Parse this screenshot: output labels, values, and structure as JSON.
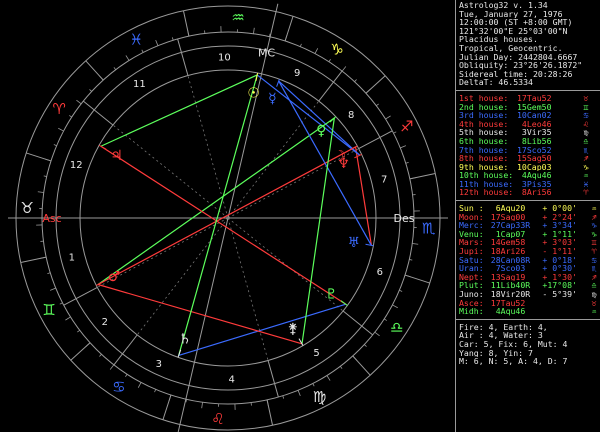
{
  "header": {
    "lines": [
      "Astrolog32 v. 1.34",
      "Tue, January 27, 1976",
      "12:00:00 (ST +8:00 GMT)",
      "121°32'00\"E 25°03'00\"N",
      "Placidus houses.",
      "Tropical, Geocentric.",
      "Julian Day: 2442804.6667",
      "Obliquity: 23°26'26.1872\"",
      "Sidereal time: 20:28:26",
      "DeltaT: 46.5334"
    ]
  },
  "houses": [
    {
      "name": "1st house:",
      "cusp": "17Tau52",
      "sign": "♉",
      "color": "#ff3b3b"
    },
    {
      "name": "2nd house:",
      "cusp": "15Gem50",
      "sign": "♊",
      "color": "#5cff5c"
    },
    {
      "name": "3rd house:",
      "cusp": "10Can02",
      "sign": "♋",
      "color": "#3b6bff"
    },
    {
      "name": "4th house:",
      "cusp": " 4Leo46",
      "sign": "♌",
      "color": "#ff3b3b"
    },
    {
      "name": "5th house:",
      "cusp": " 3Vir35",
      "sign": "♍",
      "color": "#e8e8e8"
    },
    {
      "name": "6th house:",
      "cusp": " 8Lib56",
      "sign": "♎",
      "color": "#5cff5c"
    },
    {
      "name": "7th house:",
      "cusp": "17Sco52",
      "sign": "♏",
      "color": "#3b6bff"
    },
    {
      "name": "8th house:",
      "cusp": "15Sag50",
      "sign": "♐",
      "color": "#ff3b3b"
    },
    {
      "name": "9th house:",
      "cusp": "10Cap03",
      "sign": "♑",
      "color": "#ffff55"
    },
    {
      "name": "10th house:",
      "cusp": " 4Aqu46",
      "sign": "♒",
      "color": "#5cff5c"
    },
    {
      "name": "11th house:",
      "cusp": " 3Pis35",
      "sign": "♓",
      "color": "#3b6bff"
    },
    {
      "name": "12th house:",
      "cusp": " 8Ari56",
      "sign": "♈",
      "color": "#ff3b3b"
    }
  ],
  "planets": [
    {
      "name": "Sun :",
      "pos": " 6Aqu20",
      "lat": "+ 0°00'",
      "sign": "♒",
      "color": "#ffff55"
    },
    {
      "name": "Moon:",
      "pos": "17Sag00",
      "lat": "+ 2°24'",
      "sign": "♐",
      "color": "#ff3b3b"
    },
    {
      "name": "Merc:",
      "pos": "27Cap33R",
      "lat": "+ 3°34'",
      "sign": "♑",
      "color": "#3b6bff"
    },
    {
      "name": "Venu:",
      "pos": " 1Cap07",
      "lat": "+ 1°11'",
      "sign": "♑",
      "color": "#5cff5c"
    },
    {
      "name": "Mars:",
      "pos": "14Gem58",
      "lat": "+ 3°03'",
      "sign": "♊",
      "color": "#ff3b3b"
    },
    {
      "name": "Jupi:",
      "pos": "18Ari26",
      "lat": "- 1°11'",
      "sign": "♈",
      "color": "#ff3b3b"
    },
    {
      "name": "Satu:",
      "pos": "28Can08R",
      "lat": "+ 0°18'",
      "sign": "♋",
      "color": "#3b6bff"
    },
    {
      "name": "Uran:",
      "pos": " 7Sco03",
      "lat": "+ 0°30'",
      "sign": "♏",
      "color": "#3b6bff"
    },
    {
      "name": "Nept:",
      "pos": "13Sag19",
      "lat": "+ 1°30'",
      "sign": "♐",
      "color": "#ff3b3b"
    },
    {
      "name": "Plut:",
      "pos": "11Lib40R",
      "lat": "+17°08'",
      "sign": "♎",
      "color": "#5cff5c"
    },
    {
      "name": "Juno:",
      "pos": "18Vir20R",
      "lat": "- 5°39'",
      "sign": "♍",
      "color": "#e8e8e8"
    },
    {
      "name": "Asce:",
      "pos": "17Tau52",
      "lat": "",
      "sign": "♉",
      "color": "#ff3b3b"
    },
    {
      "name": "Midh:",
      "pos": " 4Aqu46",
      "lat": "",
      "sign": "♒",
      "color": "#5cff5c"
    }
  ],
  "summary": {
    "lines": [
      "Fire: 4, Earth: 4,",
      "Air : 4, Water: 3",
      "Car: 5, Fix: 6, Mut: 4",
      "Yang: 8, Yin: 7",
      "M: 6, N: 5, A: 4, D: 7"
    ]
  },
  "wheel": {
    "zodiac": [
      {
        "glyph": "♈",
        "color": "#ff3b3b"
      },
      {
        "glyph": "♉",
        "color": "#e8e8e8"
      },
      {
        "glyph": "♊",
        "color": "#5cff5c"
      },
      {
        "glyph": "♋",
        "color": "#3b6bff"
      },
      {
        "glyph": "♌",
        "color": "#ff3b3b"
      },
      {
        "glyph": "♍",
        "color": "#e8e8e8"
      },
      {
        "glyph": "♎",
        "color": "#5cff5c"
      },
      {
        "glyph": "♏",
        "color": "#3b6bff"
      },
      {
        "glyph": "♐",
        "color": "#ff3b3b"
      },
      {
        "glyph": "♑",
        "color": "#ffff55"
      },
      {
        "glyph": "♒",
        "color": "#5cff5c"
      },
      {
        "glyph": "♓",
        "color": "#3b6bff"
      }
    ],
    "house_numbers": [
      "1",
      "2",
      "3",
      "4",
      "5",
      "6",
      "7",
      "8",
      "9",
      "10",
      "11",
      "12"
    ],
    "axis_labels": {
      "asc": "Asc",
      "des": "Des",
      "mc": "MC"
    },
    "planet_glyphs": [
      {
        "name": "Sun",
        "glyph": "☉",
        "color": "#ffff55"
      },
      {
        "name": "Moon",
        "glyph": "☽",
        "color": "#ff3b3b"
      },
      {
        "name": "Mercury",
        "glyph": "☿",
        "color": "#3b6bff"
      },
      {
        "name": "Venus",
        "glyph": "♀",
        "color": "#5cff5c"
      },
      {
        "name": "Mars",
        "glyph": "♂",
        "color": "#ff3b3b"
      },
      {
        "name": "Jupiter",
        "glyph": "♃",
        "color": "#ff3b3b"
      },
      {
        "name": "Saturn",
        "glyph": "♄",
        "color": "#e8e8e8"
      },
      {
        "name": "Uranus",
        "glyph": "♅",
        "color": "#3b6bff"
      },
      {
        "name": "Neptune",
        "glyph": "♆",
        "color": "#ff3b3b"
      },
      {
        "name": "Pluto",
        "glyph": "♇",
        "color": "#5cff5c"
      },
      {
        "name": "Juno",
        "glyph": "⚵",
        "color": "#e8e8e8"
      }
    ]
  },
  "colors": {
    "background": "#000000",
    "frame": "#9a9a9a",
    "text": "#e8e8e8",
    "red": "#ff3b3b",
    "green": "#5cff5c",
    "blue": "#3b6bff",
    "yellow": "#ffff55",
    "magenta": "#ff44ff"
  }
}
